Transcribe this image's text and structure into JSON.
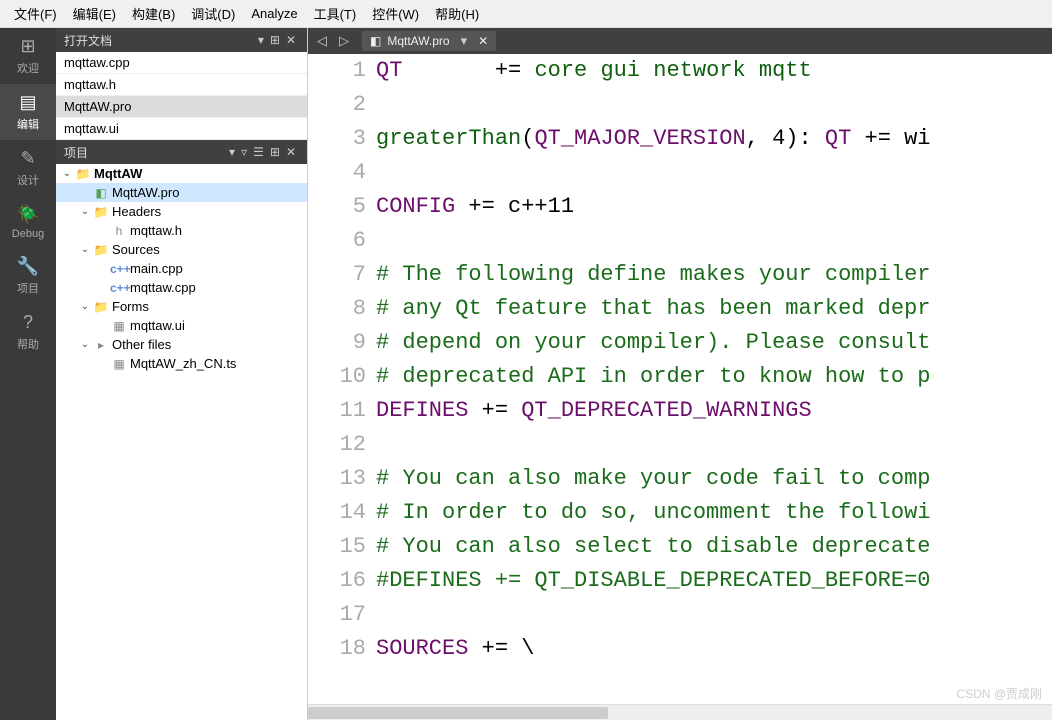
{
  "menubar": [
    {
      "label": "文件(F)"
    },
    {
      "label": "编辑(E)"
    },
    {
      "label": "构建(B)"
    },
    {
      "label": "调试(D)"
    },
    {
      "label": "Analyze"
    },
    {
      "label": "工具(T)"
    },
    {
      "label": "控件(W)"
    },
    {
      "label": "帮助(H)"
    }
  ],
  "leftbar": [
    {
      "icon": "⊞",
      "label": "欢迎"
    },
    {
      "icon": "▤",
      "label": "编辑",
      "active": true
    },
    {
      "icon": "✎",
      "label": "设计"
    },
    {
      "icon": "🪲",
      "label": "Debug"
    },
    {
      "icon": "🔧",
      "label": "项目"
    },
    {
      "icon": "?",
      "label": "帮助"
    }
  ],
  "opendocs": {
    "title": "打开文档",
    "items": [
      {
        "name": "mqttaw.cpp"
      },
      {
        "name": "mqttaw.h"
      },
      {
        "name": "MqttAW.pro",
        "active": true
      },
      {
        "name": "mqttaw.ui"
      }
    ],
    "buttons": [
      "▾",
      "⊞",
      "✕"
    ]
  },
  "project": {
    "title": "项目",
    "buttons": [
      "▾",
      "▿",
      "☰",
      "⊞",
      "✕"
    ]
  },
  "tree": [
    {
      "depth": 0,
      "chev": "⌄",
      "icon": "📁",
      "iconClass": "pro-ico",
      "label": "MqttAW",
      "bold": true
    },
    {
      "depth": 1,
      "chev": "",
      "icon": "◧",
      "iconClass": "pro-ico",
      "label": "MqttAW.pro",
      "selected": true
    },
    {
      "depth": 1,
      "chev": "⌄",
      "icon": "📁",
      "iconClass": "folder-ico",
      "label": "Headers"
    },
    {
      "depth": 2,
      "chev": "",
      "icon": "h",
      "iconClass": "file-ico",
      "label": "mqttaw.h"
    },
    {
      "depth": 1,
      "chev": "⌄",
      "icon": "📁",
      "iconClass": "folder-ico",
      "label": "Sources"
    },
    {
      "depth": 2,
      "chev": "",
      "icon": "c++",
      "iconClass": "cpp-ico",
      "label": "main.cpp"
    },
    {
      "depth": 2,
      "chev": "",
      "icon": "c++",
      "iconClass": "cpp-ico",
      "label": "mqttaw.cpp"
    },
    {
      "depth": 1,
      "chev": "⌄",
      "icon": "📁",
      "iconClass": "folder-ico",
      "label": "Forms"
    },
    {
      "depth": 2,
      "chev": "",
      "icon": "▦",
      "iconClass": "file-ico",
      "label": "mqttaw.ui"
    },
    {
      "depth": 1,
      "chev": "⌄",
      "icon": "▸",
      "iconClass": "file-ico",
      "label": "Other files"
    },
    {
      "depth": 2,
      "chev": "",
      "icon": "▦",
      "iconClass": "file-ico",
      "label": "MqttAW_zh_CN.ts"
    }
  ],
  "editor": {
    "back": "◁",
    "forward": "▷",
    "tab_icon": "◧",
    "tab_label": "MqttAW.pro",
    "tab_drop": "▾",
    "tab_close": "✕"
  },
  "code_lines": [
    {
      "n": 1,
      "seg": [
        {
          "c": "kw",
          "t": "QT"
        },
        {
          "t": "       += "
        },
        {
          "c": "fn",
          "t": "core gui network mqtt"
        }
      ]
    },
    {
      "n": 2,
      "seg": []
    },
    {
      "n": 3,
      "seg": [
        {
          "c": "fn",
          "t": "greaterThan"
        },
        {
          "t": "("
        },
        {
          "c": "mc",
          "t": "QT_MAJOR_VERSION"
        },
        {
          "t": ", 4): "
        },
        {
          "c": "kw",
          "t": "QT"
        },
        {
          "t": " += wi"
        }
      ]
    },
    {
      "n": 4,
      "seg": []
    },
    {
      "n": 5,
      "seg": [
        {
          "c": "kw",
          "t": "CONFIG"
        },
        {
          "t": " += c++11"
        }
      ]
    },
    {
      "n": 6,
      "seg": []
    },
    {
      "n": 7,
      "seg": [
        {
          "c": "cm",
          "t": "# The following define makes your compiler"
        }
      ]
    },
    {
      "n": 8,
      "seg": [
        {
          "c": "cm",
          "t": "# any Qt feature that has been marked depr"
        }
      ]
    },
    {
      "n": 9,
      "seg": [
        {
          "c": "cm",
          "t": "# depend on your compiler). Please consult"
        }
      ]
    },
    {
      "n": 10,
      "seg": [
        {
          "c": "cm",
          "t": "# deprecated API in order to know how to p"
        }
      ]
    },
    {
      "n": 11,
      "seg": [
        {
          "c": "kw",
          "t": "DEFINES"
        },
        {
          "t": " += "
        },
        {
          "c": "mc",
          "t": "QT_DEPRECATED_WARNINGS"
        }
      ]
    },
    {
      "n": 12,
      "seg": []
    },
    {
      "n": 13,
      "seg": [
        {
          "c": "cm",
          "t": "# You can also make your code fail to comp"
        }
      ]
    },
    {
      "n": 14,
      "seg": [
        {
          "c": "cm",
          "t": "# In order to do so, uncomment the followi"
        }
      ]
    },
    {
      "n": 15,
      "seg": [
        {
          "c": "cm",
          "t": "# You can also select to disable deprecate"
        }
      ]
    },
    {
      "n": 16,
      "seg": [
        {
          "c": "cm",
          "t": "#DEFINES += QT_DISABLE_DEPRECATED_BEFORE=0"
        }
      ]
    },
    {
      "n": 17,
      "seg": []
    },
    {
      "n": 18,
      "seg": [
        {
          "c": "kw",
          "t": "SOURCES"
        },
        {
          "t": " += \\"
        }
      ]
    }
  ],
  "watermark": "CSDN @贾成刚"
}
